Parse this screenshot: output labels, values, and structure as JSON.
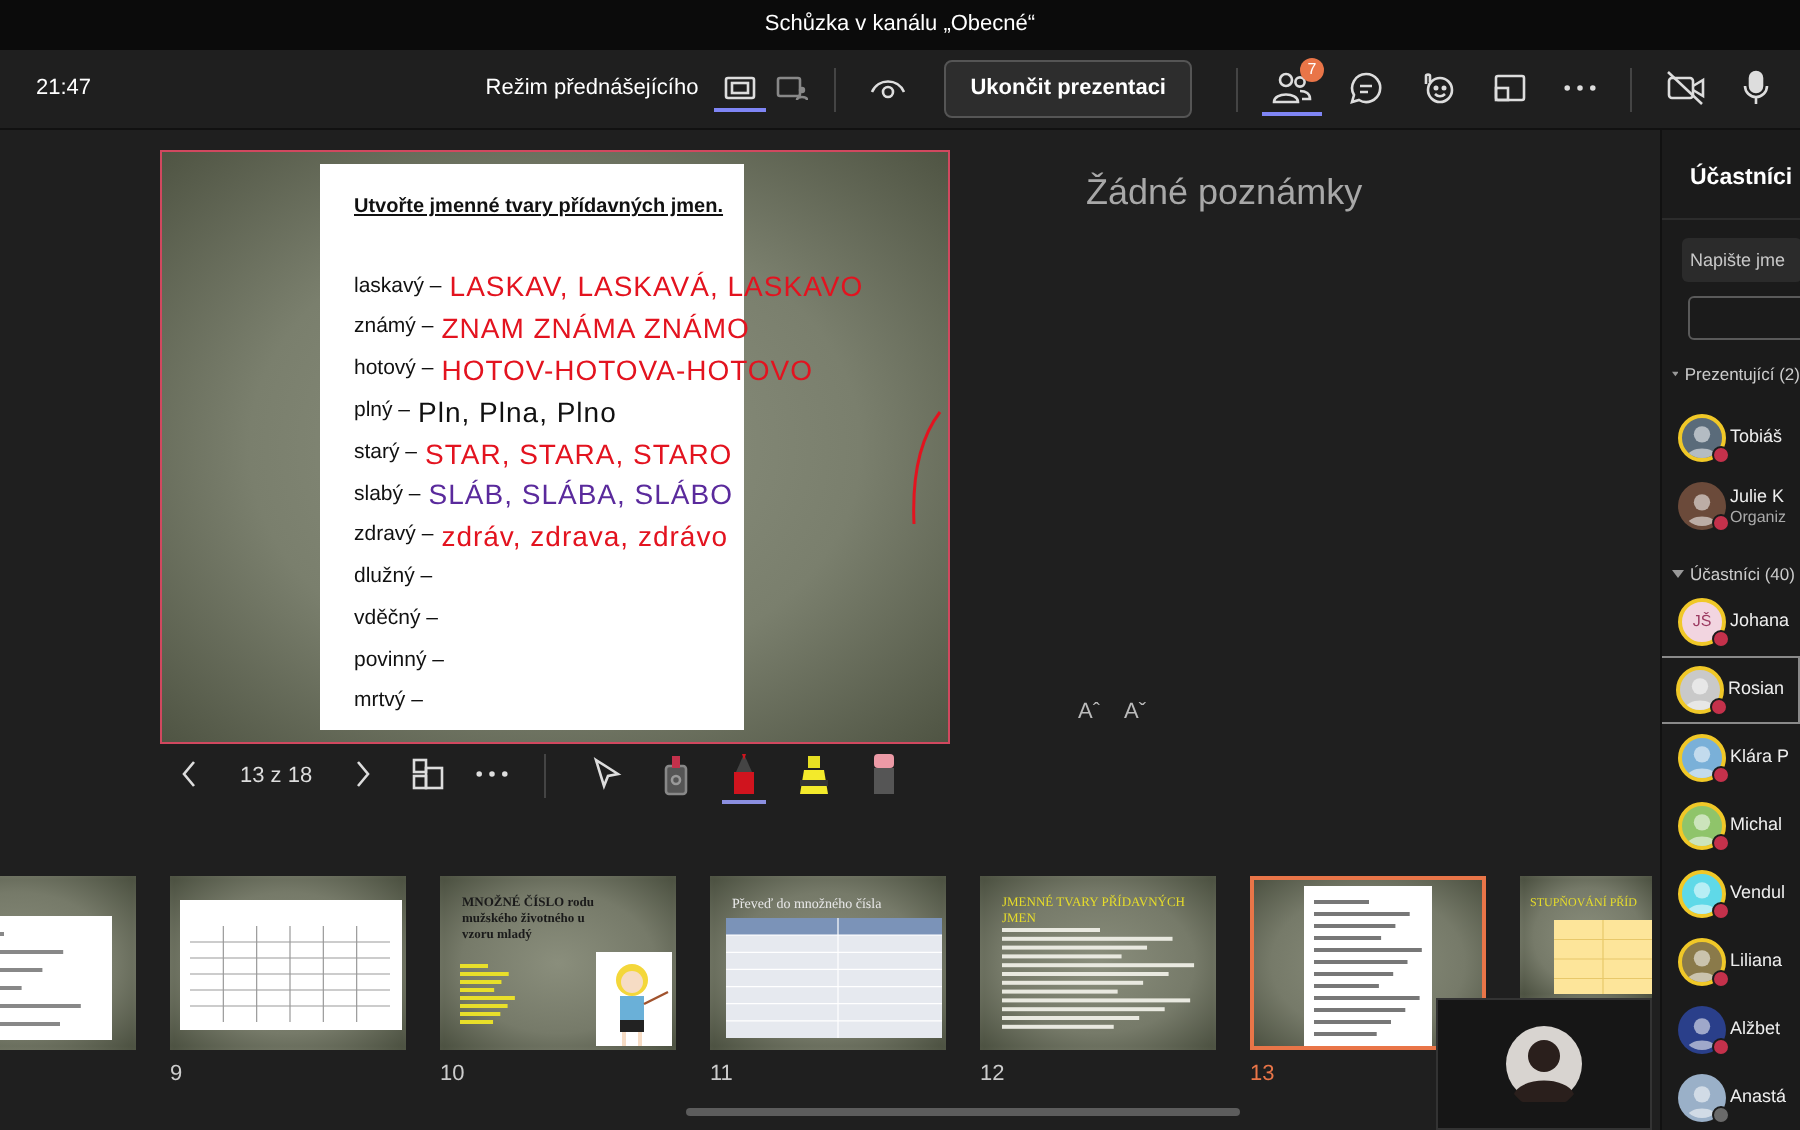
{
  "window": {
    "title": "Schůzka v kanálu „Obecné“"
  },
  "toolbar": {
    "time": "21:47",
    "presenter_mode": "Režim přednášejícího",
    "views": [
      {
        "kind": "standard",
        "selected": true
      },
      {
        "kind": "side",
        "selected": false
      }
    ],
    "end_button": "Ukončit prezentaci",
    "tools": [
      {
        "kind": "people",
        "badge": "7",
        "selected": true
      },
      {
        "kind": "chat",
        "selected": false
      },
      {
        "kind": "reactions",
        "selected": false
      },
      {
        "kind": "share",
        "selected": false
      },
      {
        "kind": "more",
        "selected": false
      }
    ],
    "devices": [
      {
        "kind": "camera",
        "on": false
      },
      {
        "kind": "mic",
        "on": true
      }
    ]
  },
  "slide": {
    "title": "Utvořte jmenné tvary přídavných jmen.",
    "rows": [
      {
        "word": "laskavý –",
        "ink": "LASKAV, LASKAVÁ, LASKAVO",
        "color": "#e3131f"
      },
      {
        "word": "známý –",
        "ink": "ZNAM ZNÁMA ZNÁMO",
        "color": "#e3131f"
      },
      {
        "word": "hotový –",
        "ink": "HOTOV-HOTOVA-HOTOVO",
        "color": "#e3131f"
      },
      {
        "word": "plný –",
        "ink": "Pln, Plna, Plno",
        "color": "#111111"
      },
      {
        "word": "starý –",
        "ink": "STAR, STARA, STARO",
        "color": "#e3131f"
      },
      {
        "word": "slabý –",
        "ink": "SLÁB, SLÁBA, SLÁBO",
        "color": "#5a2a9c"
      },
      {
        "word": "zdravý –",
        "ink": "zdráv, zdrava, zdrávo",
        "color": "#e3131f"
      },
      {
        "word": "dlužný –"
      },
      {
        "word": "vděčný –"
      },
      {
        "word": "povinný –"
      },
      {
        "word": "mrtvý –"
      }
    ]
  },
  "notes": {
    "placeholder": "Žádné poznámky",
    "font_buttons": [
      "Aˆ",
      "Aˇ"
    ]
  },
  "slide_controls": {
    "counter": "13 z 18",
    "tools": [
      {
        "kind": "pointer",
        "selected": false
      },
      {
        "kind": "laser",
        "selected": false
      },
      {
        "kind": "pen",
        "selected": true
      },
      {
        "kind": "highlighter",
        "selected": false
      },
      {
        "kind": "eraser",
        "selected": false
      }
    ]
  },
  "thumbnails": [
    {
      "kind": "worksheet",
      "selected": false
    },
    {
      "number": "9",
      "kind": "table",
      "selected": false
    },
    {
      "number": "10",
      "kind": "title-picture",
      "title": "MNOŽNÉ ČÍSLO rodu mužského životného u vzoru mladý",
      "selected": false
    },
    {
      "number": "11",
      "kind": "table-list",
      "title": "Převeď do množného čísla",
      "selected": false
    },
    {
      "number": "12",
      "kind": "bullets",
      "title": "JMENNÉ TVARY PŘÍDAVNÝCH JMEN",
      "selected": false
    },
    {
      "number": "13",
      "kind": "worksheet-slide",
      "selected": true
    },
    {
      "kind": "table-yellow",
      "title": "STUPŇOVÁNÍ PŘÍD",
      "selected": false
    }
  ],
  "participants": {
    "title": "Účastníci",
    "search": {
      "placeholder": "Napište jme"
    },
    "groups": [
      {
        "label": "Prezentující (2)",
        "expanded": true,
        "people": [
          {
            "name": "Tobiáš",
            "ring": true,
            "busy": true,
            "selected": false
          },
          {
            "name": "Julie K",
            "subtitle": "Organiz",
            "ring": false,
            "busy": true,
            "selected": false
          }
        ]
      },
      {
        "label": "Účastníci (40)",
        "expanded": true,
        "people": [
          {
            "name": "Johana",
            "initials": "JŠ",
            "ring": true,
            "busy": true,
            "selected": false
          },
          {
            "name": "Rosian",
            "ring": true,
            "busy": true,
            "selected": true
          },
          {
            "name": "Klára P",
            "ring": true,
            "busy": true,
            "selected": false
          },
          {
            "name": "Michal",
            "ring": true,
            "busy": true,
            "selected": false
          },
          {
            "name": "Vendul",
            "ring": true,
            "busy": true,
            "selected": false
          },
          {
            "name": "Liliana",
            "ring": true,
            "busy": true,
            "selected": false
          },
          {
            "name": "Alžbet",
            "ring": false,
            "busy": true,
            "selected": false
          },
          {
            "name": "Anastá",
            "ring": false,
            "busy": false,
            "selected": false
          }
        ]
      }
    ]
  }
}
